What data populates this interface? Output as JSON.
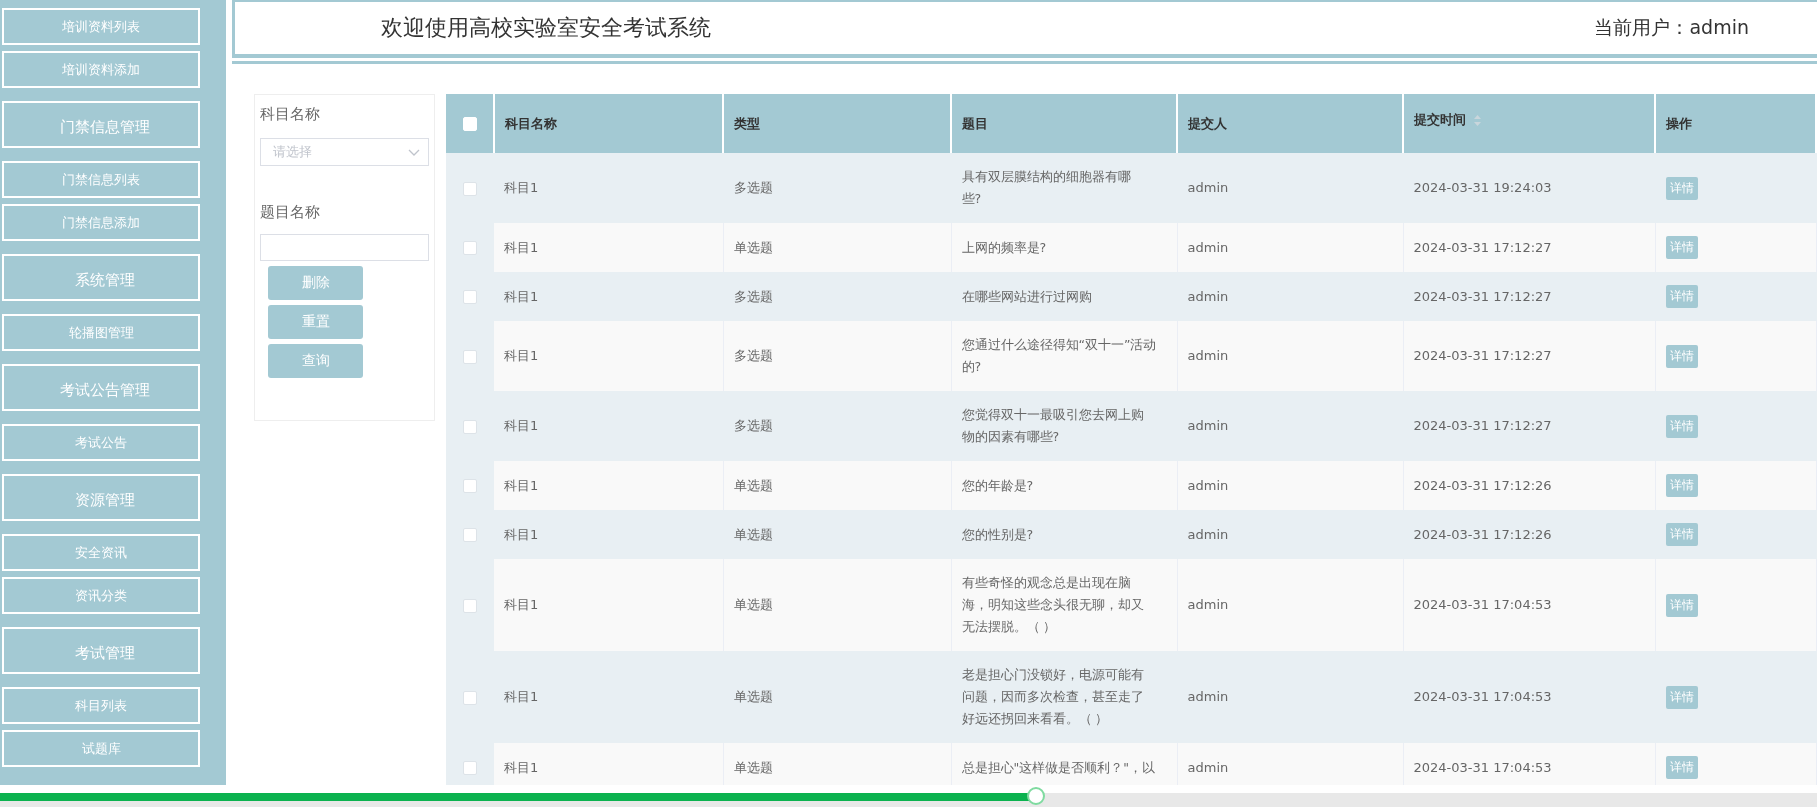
{
  "sidebar": {
    "items": [
      {
        "label": "培训资料列表",
        "kind": "link"
      },
      {
        "label": "培训资料添加",
        "kind": "link"
      },
      {
        "label": "门禁信息管理",
        "kind": "group"
      },
      {
        "label": "门禁信息列表",
        "kind": "link"
      },
      {
        "label": "门禁信息添加",
        "kind": "link"
      },
      {
        "label": "系统管理",
        "kind": "group"
      },
      {
        "label": "轮播图管理",
        "kind": "link"
      },
      {
        "label": "考试公告管理",
        "kind": "group"
      },
      {
        "label": "考试公告",
        "kind": "link"
      },
      {
        "label": "资源管理",
        "kind": "group"
      },
      {
        "label": "安全资讯",
        "kind": "link"
      },
      {
        "label": "资讯分类",
        "kind": "link"
      },
      {
        "label": "考试管理",
        "kind": "group"
      },
      {
        "label": "科目列表",
        "kind": "link"
      },
      {
        "label": "试题库",
        "kind": "link"
      }
    ]
  },
  "header": {
    "title": "欢迎使用高校实验室安全考试系统",
    "current_user": "当前用户：admin"
  },
  "filters": {
    "subject_label": "科目名称",
    "subject_select": {
      "placeholder": "请选择"
    },
    "question_label": "题目名称",
    "buttons": [
      "删除",
      "重置",
      "查询"
    ]
  },
  "table": {
    "select_all": {
      "checked": false
    },
    "columns": [
      {
        "label": "科目名称",
        "sortable": false
      },
      {
        "label": "类型",
        "sortable": false
      },
      {
        "label": "题目",
        "sortable": false
      },
      {
        "label": "提交人",
        "sortable": false
      },
      {
        "label": "提交时间",
        "sortable": true
      },
      {
        "label": "操作",
        "sortable": false
      }
    ],
    "rows": [
      {
        "checked": false,
        "subject": "科目1",
        "type": "多选题",
        "question": [
          "具有双层膜结构的细胞器有哪",
          "些?"
        ],
        "submitter": "admin",
        "time": "2024-03-31 19:24:03",
        "action": "详情"
      },
      {
        "checked": false,
        "subject": "科目1",
        "type": "单选题",
        "question": [
          "上网的频率是?"
        ],
        "submitter": "admin",
        "time": "2024-03-31 17:12:27",
        "action": "详情"
      },
      {
        "checked": false,
        "subject": "科目1",
        "type": "多选题",
        "question": [
          "在哪些网站进行过网购"
        ],
        "submitter": "admin",
        "time": "2024-03-31 17:12:27",
        "action": "详情"
      },
      {
        "checked": false,
        "subject": "科目1",
        "type": "多选题",
        "question": [
          "您通过什么途径得知“双十一”活动",
          "的?"
        ],
        "submitter": "admin",
        "time": "2024-03-31 17:12:27",
        "action": "详情"
      },
      {
        "checked": false,
        "subject": "科目1",
        "type": "多选题",
        "question": [
          "您觉得双十一最吸引您去网上购",
          "物的因素有哪些?"
        ],
        "submitter": "admin",
        "time": "2024-03-31 17:12:27",
        "action": "详情"
      },
      {
        "checked": false,
        "subject": "科目1",
        "type": "单选题",
        "question": [
          "您的年龄是?"
        ],
        "submitter": "admin",
        "time": "2024-03-31 17:12:26",
        "action": "详情"
      },
      {
        "checked": false,
        "subject": "科目1",
        "type": "单选题",
        "question": [
          "您的性别是?"
        ],
        "submitter": "admin",
        "time": "2024-03-31 17:12:26",
        "action": "详情"
      },
      {
        "checked": false,
        "subject": "科目1",
        "type": "单选题",
        "question": [
          "有些奇怪的观念总是出现在脑",
          "海，明知这些念头很无聊，却又",
          "无法摆脱。（ ）"
        ],
        "submitter": "admin",
        "time": "2024-03-31 17:04:53",
        "action": "详情"
      },
      {
        "checked": false,
        "subject": "科目1",
        "type": "单选题",
        "question": [
          "老是担心门没锁好，电源可能有",
          "问题，因而多次检查，甚至走了",
          "好远还拐回来看看。（ ）"
        ],
        "submitter": "admin",
        "time": "2024-03-31 17:04:53",
        "action": "详情"
      },
      {
        "checked": false,
        "subject": "科目1",
        "type": "单选题",
        "question": [
          "总是担心\"这样做是否顺利？\"，以"
        ],
        "submitter": "admin",
        "time": "2024-03-31 17:04:53",
        "action": "详情"
      }
    ]
  },
  "playback": {
    "level": 0.57
  }
}
